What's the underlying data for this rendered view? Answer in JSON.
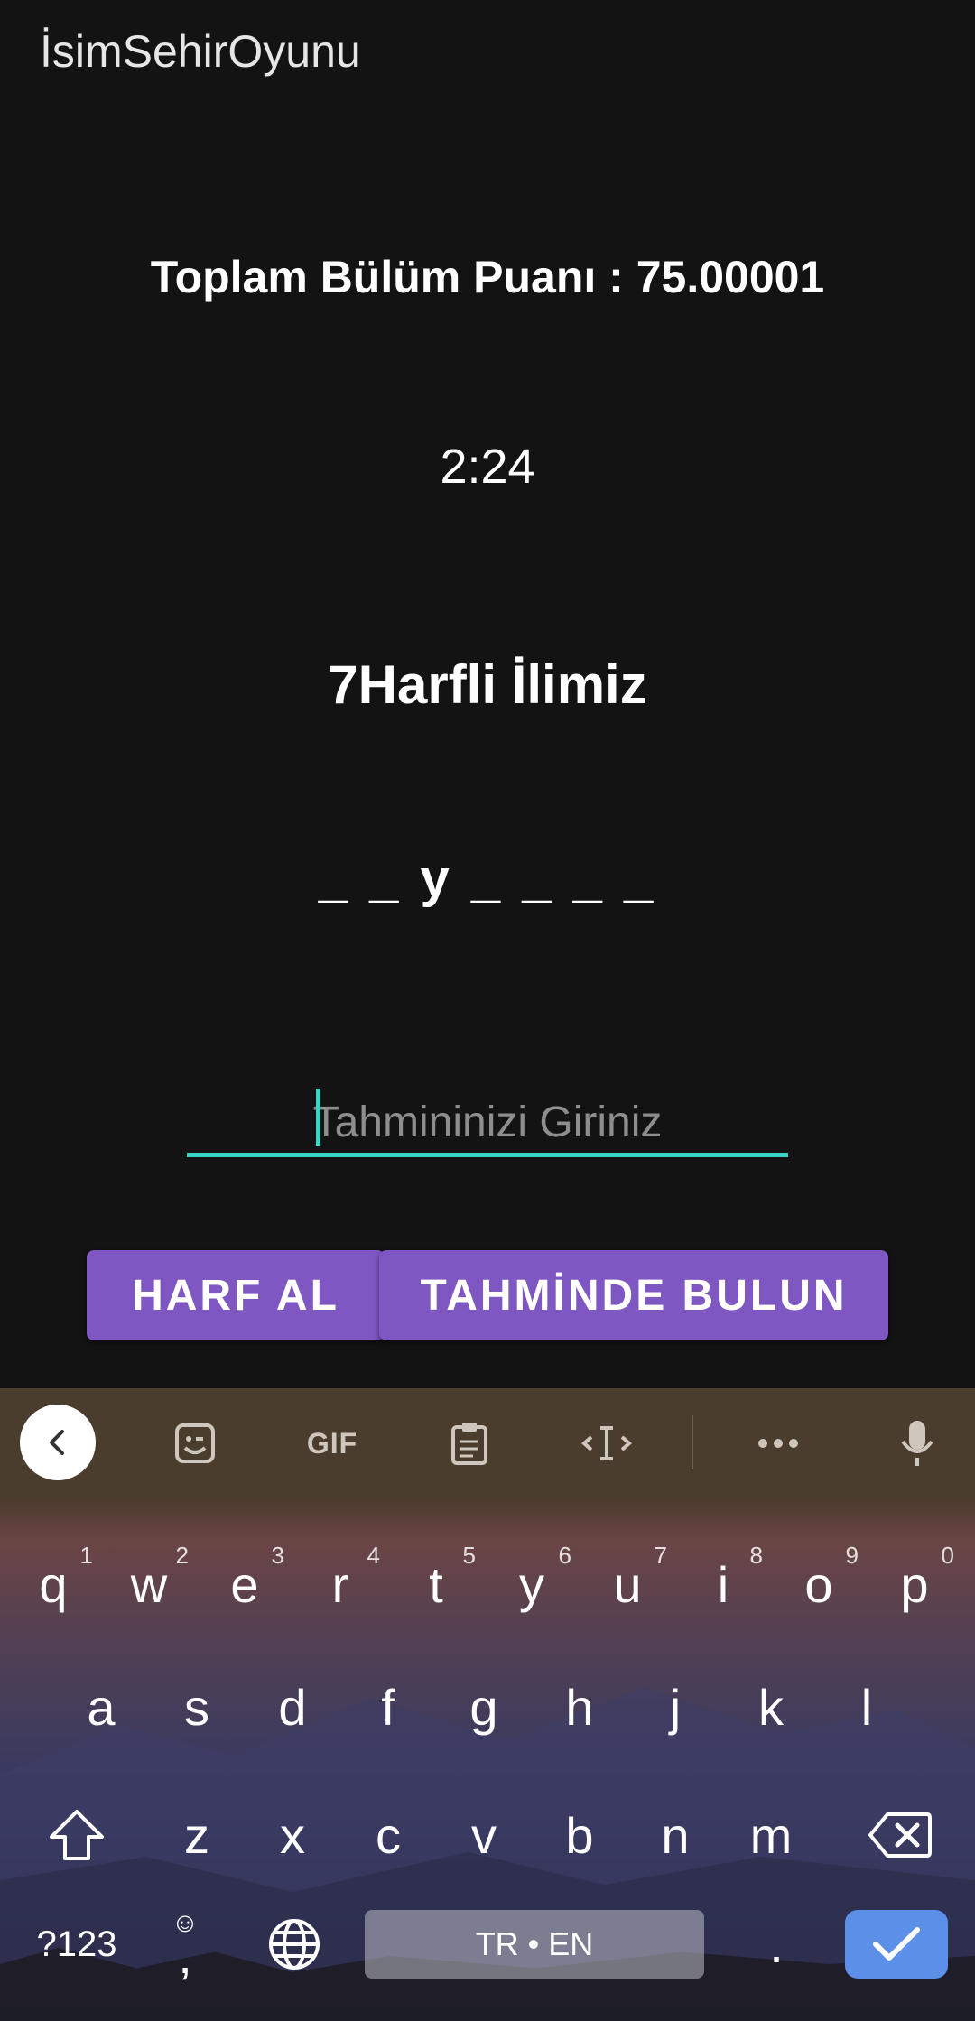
{
  "app": {
    "title": "İsimSehirOyunu",
    "score_text": "Toplam Bülüm Puanı : 75.00001",
    "timer": "2:24",
    "hint": "7Harfli İlimiz",
    "pattern": "_ _ y _ _ _ _",
    "guess": {
      "placeholder": "Tahmininizi Giriniz",
      "value": ""
    },
    "buttons": {
      "harf_al": "HARF AL",
      "tahmin": "TAHMİNDE BULUN"
    },
    "colors": {
      "background": "#131313",
      "accent": "#3ad6c5",
      "button": "#7e57c2",
      "enter_key": "#5b8fe8"
    }
  },
  "keyboard": {
    "toolbar": [
      "back-icon",
      "sticker-icon",
      "GIF",
      "clipboard-icon",
      "text-cursor-icon",
      "more-icon",
      "mic-icon"
    ],
    "gif_label": "GIF",
    "row1": [
      {
        "k": "q",
        "n": "1"
      },
      {
        "k": "w",
        "n": "2"
      },
      {
        "k": "e",
        "n": "3"
      },
      {
        "k": "r",
        "n": "4"
      },
      {
        "k": "t",
        "n": "5"
      },
      {
        "k": "y",
        "n": "6"
      },
      {
        "k": "u",
        "n": "7"
      },
      {
        "k": "i",
        "n": "8"
      },
      {
        "k": "o",
        "n": "9"
      },
      {
        "k": "p",
        "n": "0"
      }
    ],
    "row2": [
      "a",
      "s",
      "d",
      "f",
      "g",
      "h",
      "j",
      "k",
      "l"
    ],
    "row3": [
      "z",
      "x",
      "c",
      "v",
      "b",
      "n",
      "m"
    ],
    "symbols_key": "?123",
    "comma_key": ",",
    "space_label": "TR • EN",
    "period_key": "."
  }
}
